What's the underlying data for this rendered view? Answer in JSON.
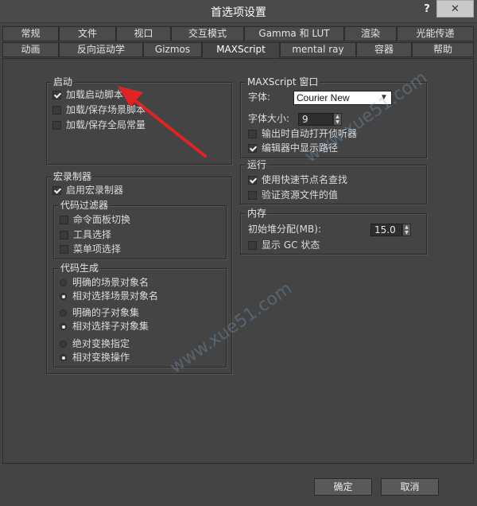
{
  "window": {
    "title": "首选项设置",
    "help": "?",
    "close": "✕"
  },
  "tabs_row1": [
    "常规",
    "文件",
    "视口",
    "交互模式",
    "Gamma 和 LUT",
    "渲染",
    "光能传递"
  ],
  "tabs_row2": [
    "动画",
    "反向运动学",
    "Gizmos",
    "MAXScript",
    "mental ray",
    "容器",
    "帮助"
  ],
  "active_tab": "MAXScript",
  "startup": {
    "title": "启动",
    "items": [
      {
        "label": "加载启动脚本",
        "checked": true
      },
      {
        "label": "加载/保存场景脚本",
        "checked": false
      },
      {
        "label": "加载/保存全局常量",
        "checked": false
      }
    ]
  },
  "macro_recorder": {
    "title": "宏录制器",
    "enable": {
      "label": "启用宏录制器",
      "checked": true
    },
    "filter": {
      "title": "代码过滤器",
      "items": [
        {
          "label": "命令面板切换",
          "checked": false
        },
        {
          "label": "工具选择",
          "checked": false
        },
        {
          "label": "菜单项选择",
          "checked": false
        }
      ]
    },
    "codegen": {
      "title": "代码生成",
      "pairs": [
        [
          {
            "label": "明确的场景对象名",
            "selected": false
          },
          {
            "label": "相对选择场景对象名",
            "selected": true
          }
        ],
        [
          {
            "label": "明确的子对象集",
            "selected": false
          },
          {
            "label": "相对选择子对象集",
            "selected": true
          }
        ],
        [
          {
            "label": "绝对变换指定",
            "selected": false
          },
          {
            "label": "相对变换操作",
            "selected": true
          }
        ]
      ]
    }
  },
  "maxscript_window": {
    "title": "MAXScript 窗口",
    "font_label": "字体:",
    "font_value": "Courier New",
    "font_size_label": "字体大小:",
    "font_size_value": "9",
    "items": [
      {
        "label": "输出时自动打开侦听器",
        "checked": false
      },
      {
        "label": "编辑器中显示路径",
        "checked": true
      }
    ]
  },
  "run": {
    "title": "运行",
    "items": [
      {
        "label": "使用快速节点名查找",
        "checked": true
      },
      {
        "label": "验证资源文件的值",
        "checked": false
      }
    ]
  },
  "memory": {
    "title": "内存",
    "heap_label": "初始堆分配(MB):",
    "heap_value": "15.0",
    "gc": {
      "label": "显示 GC 状态",
      "checked": false
    }
  },
  "buttons": {
    "ok": "确定",
    "cancel": "取消"
  },
  "watermark": "www.xue51.com"
}
